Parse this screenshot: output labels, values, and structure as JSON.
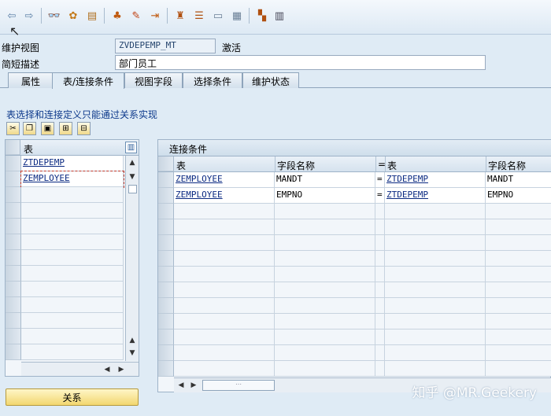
{
  "toolbar": {
    "icons": [
      "back-arrow-icon",
      "forward-arrow-icon",
      "glasses-icon",
      "settings-icon",
      "clipboard-icon",
      "hierarchy-icon",
      "pencil-icon",
      "export-icon",
      "tree-icon",
      "list-icon",
      "window-icon",
      "table-icon",
      "layout-icon",
      "grid-icon"
    ]
  },
  "header": {
    "view_label": "维护视图",
    "view_name": "ZVDEPEMP_MT",
    "status": "激活",
    "desc_label": "简短描述",
    "desc_value": "部门员工"
  },
  "tabs": [
    "属性",
    "表/连接条件",
    "视图字段",
    "选择条件",
    "维护状态"
  ],
  "active_tab": "表/连接条件",
  "info_text": "表选择和连接定义只能通过关系实现",
  "left_table": {
    "header": "表",
    "rows": [
      "ZTDEPEMP",
      "ZEMPLOYEE"
    ]
  },
  "join": {
    "title": "连接条件",
    "headers": [
      "表",
      "字段名称",
      "=",
      "表",
      "字段名称"
    ],
    "rows": [
      [
        "ZEMPLOYEE",
        "MANDT",
        "=",
        "ZTDEPEMP",
        "MANDT"
      ],
      [
        "ZEMPLOYEE",
        "EMPNO",
        "=",
        "ZTDEPEMP",
        "EMPNO"
      ]
    ]
  },
  "relation_button": "关系",
  "watermark": "知乎 @MR.Geekery"
}
